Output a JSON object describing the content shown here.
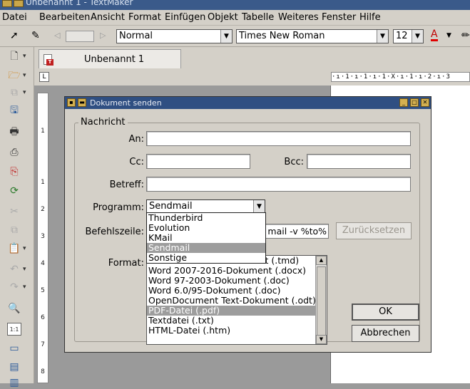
{
  "app": {
    "title": "Unbenannt 1 - TextMaker"
  },
  "menu": [
    "Datei",
    "Bearbeiten",
    "Ansicht",
    "Format",
    "Einfügen",
    "Objekt",
    "Tabelle",
    "Weiteres",
    "Fenster",
    "Hilfe"
  ],
  "toolbar": {
    "style": "Normal",
    "font": "Times New Roman",
    "size": "12",
    "font_color_label": "A"
  },
  "tab": {
    "label": "Unbenannt 1"
  },
  "ruler": {
    "scale": "·ı·1·ı·1·ı·1·X·ı·1·ı·2·ı·3",
    "corner": "L"
  },
  "vruler": [
    "1",
    "1",
    "2",
    "3",
    "4",
    "5",
    "6",
    "7",
    "8"
  ],
  "dialog": {
    "title": "Dokument senden",
    "group_label": "Nachricht",
    "to_label": "An:",
    "cc_label": "Cc:",
    "bcc_label": "Bcc:",
    "subject_label": "Betreff:",
    "program_label": "Programm:",
    "program_value": "Sendmail",
    "program_options": [
      "Thunderbird",
      "Evolution",
      "KMail",
      "Sendmail",
      "Sonstige"
    ],
    "program_selected_index": 3,
    "command_label": "Befehlszeile:",
    "command_value": ") | mail -v %to%",
    "reset_label": "Zurücksetzen",
    "format_label": "Format:",
    "format_options": [
      "TextMaker 2016-Dokument (.tmd)",
      "Word 2007-2016-Dokument (.docx)",
      "Word 97-2003-Dokument (.doc)",
      "Word 6.0/95-Dokument (.doc)",
      "OpenDocument Text-Dokument (.odt)",
      "PDF-Datei (.pdf)",
      "Textdatei (.txt)",
      "HTML-Datei (.htm)"
    ],
    "format_selected_index": 5,
    "ok_label": "OK",
    "cancel_label": "Abbrechen"
  }
}
